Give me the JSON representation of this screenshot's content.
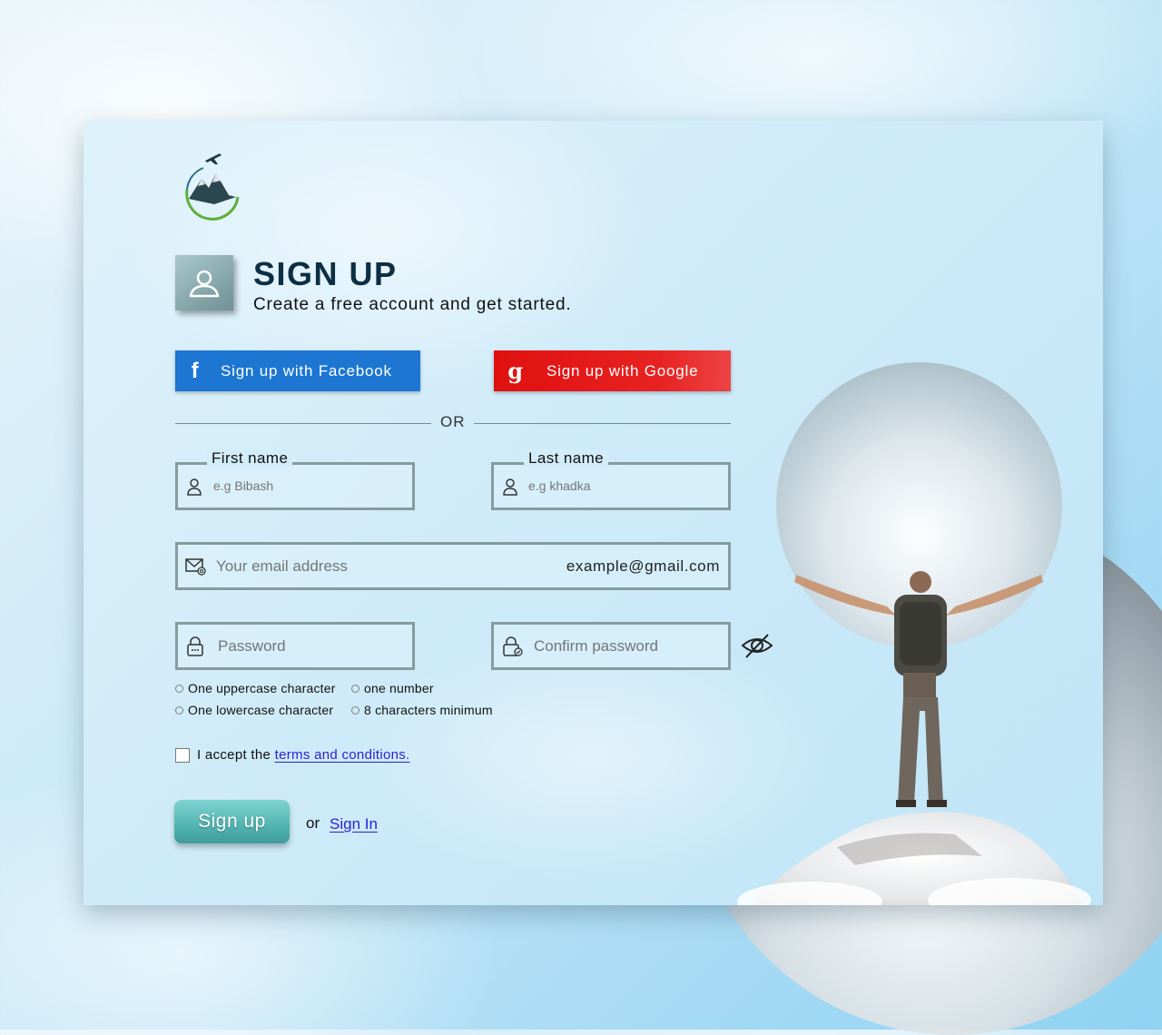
{
  "header": {
    "title": "SIGN UP",
    "subtitle": "Create a free account and get started."
  },
  "social": {
    "facebook_label": "Sign up with Facebook",
    "google_label": "Sign up with Google",
    "facebook_icon": "f",
    "google_icon": "g"
  },
  "divider": {
    "text": "OR"
  },
  "form": {
    "first_name": {
      "legend": "First name",
      "placeholder": "e.g Bibash"
    },
    "last_name": {
      "legend": "Last name",
      "placeholder": "e.g khadka"
    },
    "email": {
      "placeholder": "Your email address",
      "example": "example@gmail.com"
    },
    "password": {
      "placeholder": "Password"
    },
    "confirm_password": {
      "placeholder": "Confirm password"
    }
  },
  "requirements": [
    "One uppercase character",
    "one number",
    "One lowercase character",
    "8 characters minimum"
  ],
  "terms": {
    "prefix": "I accept the ",
    "link": "terms and conditions",
    "suffix": "."
  },
  "actions": {
    "signup_label": "Sign up",
    "or_text": "or",
    "signin_label": "Sign In"
  },
  "colors": {
    "facebook": "#1c76d2",
    "google": "#e01010",
    "title": "#0d2f44",
    "signup_button": "#55b6b3",
    "link": "#2a1fd8"
  },
  "icons": [
    "logo-plane-mountain",
    "user-icon",
    "facebook-icon",
    "google-icon",
    "mail-icon",
    "lock-icon",
    "eye-off-icon"
  ]
}
